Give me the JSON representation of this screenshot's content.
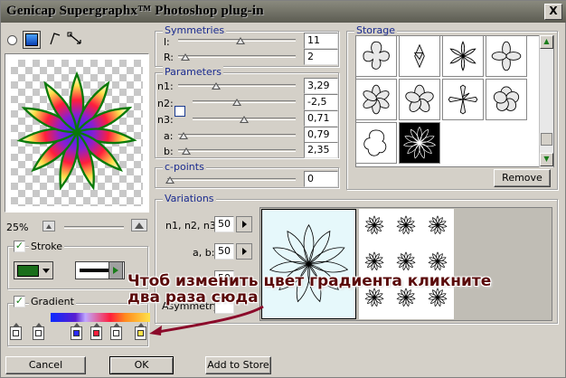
{
  "window": {
    "title": "Genicap Supergraphx™ Photoshop plug-in",
    "close_label": "X"
  },
  "left": {
    "zoom_label": "25%",
    "stroke": {
      "label": "Stroke",
      "checked": true,
      "color": "#1a6e1a"
    },
    "gradient": {
      "label": "Gradient",
      "checked": true
    }
  },
  "symmetries": {
    "title": "Symmetries",
    "l_label": "l:",
    "l_value": "11",
    "r_label": "R:",
    "r_value": "2"
  },
  "parameters": {
    "title": "Parameters",
    "rows": [
      {
        "label": "n1:",
        "value": "3,29"
      },
      {
        "label": "n2:",
        "value": "-2,5"
      },
      {
        "label": "n3:",
        "value": "0,71"
      },
      {
        "label": "a:",
        "value": "0,79"
      },
      {
        "label": "b:",
        "value": "2,35"
      }
    ]
  },
  "cpoints": {
    "title": "c-points",
    "value": "0"
  },
  "storage": {
    "title": "Storage",
    "remove_label": "Remove"
  },
  "variations": {
    "title": "Variations",
    "rows": [
      {
        "label": "n1, n2, n3:",
        "value": "50"
      },
      {
        "label": "a, b:",
        "value": "50"
      },
      {
        "label": "",
        "value": "50"
      },
      {
        "label": "Asymmetry:",
        "value": ""
      }
    ]
  },
  "annotation": {
    "line1": "Чтоб изменить цвет градиента кликните",
    "line2": "два раза сюда"
  },
  "buttons": {
    "cancel": "Cancel",
    "ok": "OK",
    "add_to_store": "Add to Store"
  },
  "colors": {
    "title_text": "#1a2b8f",
    "annotation": "#5a0a0a",
    "arrow": "#8b0a2a"
  }
}
